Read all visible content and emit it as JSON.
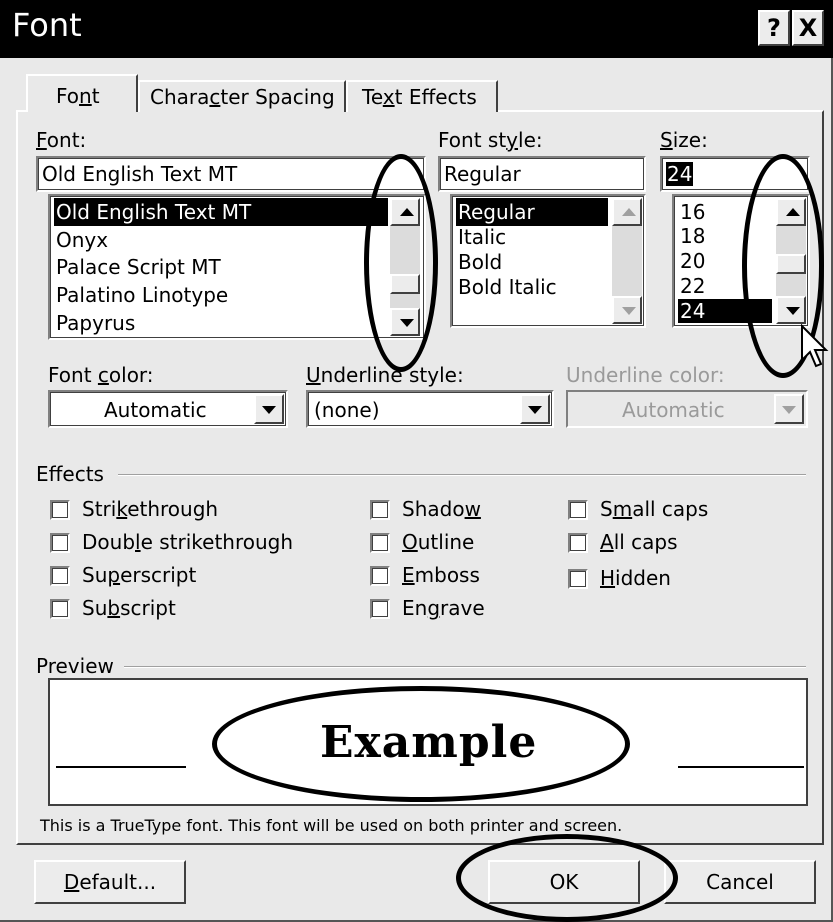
{
  "title": "Font",
  "title_buttons": {
    "help": "?",
    "close": "X"
  },
  "tabs": [
    {
      "pre": "Fo",
      "key": "n",
      "post": "t"
    },
    {
      "pre": "Chara",
      "key": "c",
      "post": "ter Spacing"
    },
    {
      "pre": "Te",
      "key": "x",
      "post": "t Effects"
    }
  ],
  "font": {
    "label_key": "F",
    "label_rest": "ont:",
    "value": "Old English Text MT",
    "items": [
      "Old English Text MT",
      "Onyx",
      "Palace Script MT",
      "Palatino Linotype",
      "Papyrus"
    ],
    "selected_index": 0
  },
  "style": {
    "label_pre": "Font st",
    "label_key": "y",
    "label_post": "le:",
    "value": "Regular",
    "items": [
      "Regular",
      "Italic",
      "Bold",
      "Bold Italic"
    ],
    "selected_index": 0
  },
  "size": {
    "label_key": "S",
    "label_rest": "ize:",
    "value": "24",
    "items": [
      "16",
      "18",
      "20",
      "22",
      "24"
    ],
    "selected_index": 4
  },
  "font_color": {
    "label_pre": "Font ",
    "label_key": "c",
    "label_post": "olor:",
    "value": "Automatic"
  },
  "underline_style": {
    "label_key": "U",
    "label_rest": "nderline style:",
    "value": "(none)"
  },
  "underline_color": {
    "label": "Underline color:",
    "value": "Automatic"
  },
  "effects": {
    "title": "Effects",
    "col1": [
      {
        "pre": "Stri",
        "key": "k",
        "post": "ethrough"
      },
      {
        "pre": "Doub",
        "key": "l",
        "post": "e strikethrough"
      },
      {
        "pre": "Su",
        "key": "p",
        "post": "erscript"
      },
      {
        "pre": "Su",
        "key": "b",
        "post": "script"
      }
    ],
    "col2": [
      {
        "pre": "Shado",
        "key": "w",
        "post": ""
      },
      {
        "pre": "",
        "key": "O",
        "post": "utline"
      },
      {
        "pre": "",
        "key": "E",
        "post": "mboss"
      },
      {
        "pre": "En",
        "key": "g",
        "post": "rave"
      }
    ],
    "col3": [
      {
        "pre": "S",
        "key": "m",
        "post": "all caps"
      },
      {
        "pre": "",
        "key": "A",
        "post": "ll caps"
      },
      {
        "pre": "",
        "key": "H",
        "post": "idden"
      }
    ]
  },
  "preview": {
    "title": "Preview",
    "sample": "Example"
  },
  "info_text": "This is a TrueType font. This font will be used on both printer and screen.",
  "buttons": {
    "default_key": "D",
    "default_rest": "efault...",
    "ok": "OK",
    "cancel": "Cancel"
  }
}
